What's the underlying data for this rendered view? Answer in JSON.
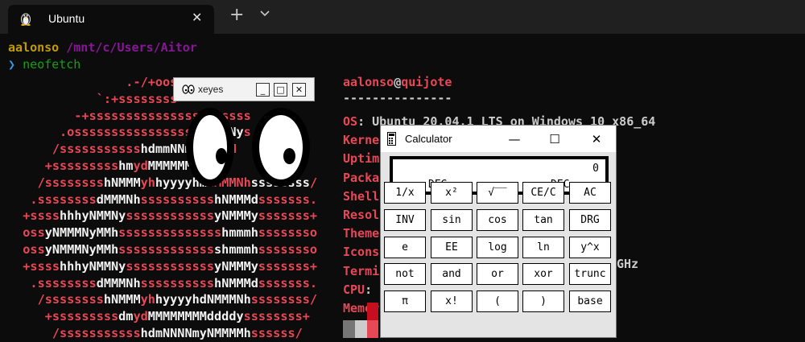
{
  "tab": {
    "title": "Ubuntu",
    "close": "✕",
    "icon": "linux-tux-icon"
  },
  "toolbar": {
    "new_tab": "+",
    "dropdown_icon": "chevron-down-icon"
  },
  "terminal": {
    "user": "aalonso",
    "path": "/mnt/c/Users/Aitor",
    "prompt_symbol": "❯",
    "command": "neofetch"
  },
  "neofetch": {
    "header_user": "aalonso",
    "header_at": "@",
    "header_host": "quijote",
    "separator": "---------------",
    "info": [
      {
        "key": "OS",
        "sep": ": ",
        "value": "Ubuntu 20.04.1 LTS on Windows 10 x86_64"
      },
      {
        "key": "Kerne",
        "sep": "",
        "value": ""
      },
      {
        "key": "Uptim",
        "sep": "",
        "value": ""
      },
      {
        "key": "Packa",
        "sep": "",
        "value": ""
      },
      {
        "key": "Shell",
        "sep": "",
        "value": ""
      },
      {
        "key": "Resol",
        "sep": "",
        "value": ""
      },
      {
        "key": "Theme",
        "sep": "",
        "value": ""
      },
      {
        "key": "Icons",
        "sep": "",
        "value": ""
      },
      {
        "key": "Termi",
        "sep": "",
        "value": ""
      },
      {
        "key": "CPU",
        "sep": ": ",
        "value": ""
      },
      {
        "key": "Memor",
        "sep": "",
        "value": ""
      }
    ],
    "cpu_tail": "GHz",
    "color_blocks": [
      "#c50f1f",
      "#e74856",
      "#767676",
      "#cccccc"
    ]
  },
  "logo_lines": [
    [
      [
        "r",
        "                .-/+oosss"
      ]
    ],
    [
      [
        "r",
        "            `:+ssssssss"
      ]
    ],
    [
      [
        "r",
        "         -+sssssssssssssssss"
      ],
      [
        "w",
        "y"
      ],
      [
        "r",
        "ssss"
      ]
    ],
    [
      [
        "r",
        "       .osssssssssssssssss"
      ],
      [
        "w",
        "dMMMNy"
      ],
      [
        "r",
        "s"
      ]
    ],
    [
      [
        "r",
        "      /sssssssssss"
      ],
      [
        "w",
        "hdmmNNm"
      ],
      [
        "r",
        "mmMMMM"
      ]
    ],
    [
      [
        "r",
        "     +sssssssss"
      ],
      [
        "w",
        "hm"
      ],
      [
        "r",
        "yd"
      ],
      [
        "w",
        "MMMMMM"
      ]
    ],
    [
      [
        "r",
        "    /ssssssss"
      ],
      [
        "w",
        "hNMMM"
      ],
      [
        "r",
        "yh"
      ],
      [
        "w",
        "hyyyyhm"
      ],
      [
        "r",
        "NMMMNh"
      ],
      [
        "w",
        "ssssssss"
      ],
      [
        "r",
        "/"
      ]
    ],
    [
      [
        "r",
        "   .ssssssss"
      ],
      [
        "w",
        "dMMMNh"
      ],
      [
        "r",
        "ssssssssss"
      ],
      [
        "w",
        "hNMMMd"
      ],
      [
        "r",
        "sssssss."
      ]
    ],
    [
      [
        "r",
        "  +ssss"
      ],
      [
        "w",
        "hhhyNMMNy"
      ],
      [
        "r",
        "ssssssssssss"
      ],
      [
        "w",
        "yNMMMy"
      ],
      [
        "r",
        "sssssss+"
      ]
    ],
    [
      [
        "r",
        "  oss"
      ],
      [
        "w",
        "yNMMMNyMMh"
      ],
      [
        "r",
        "ssssssssssssss"
      ],
      [
        "w",
        "hmmmh"
      ],
      [
        "r",
        "ssssssso"
      ]
    ],
    [
      [
        "r",
        "  oss"
      ],
      [
        "w",
        "yNMMMNyMMh"
      ],
      [
        "r",
        "sssssssssssss"
      ],
      [
        "w",
        "shmmmh"
      ],
      [
        "r",
        "ssssssso"
      ]
    ],
    [
      [
        "r",
        "  +ssss"
      ],
      [
        "w",
        "hhhyNMMNy"
      ],
      [
        "r",
        "ssssssssssss"
      ],
      [
        "w",
        "yNMMMy"
      ],
      [
        "r",
        "sssssss+"
      ]
    ],
    [
      [
        "r",
        "   .ssssssss"
      ],
      [
        "w",
        "dMMMNh"
      ],
      [
        "r",
        "ssssssssss"
      ],
      [
        "w",
        "hNMMMd"
      ],
      [
        "r",
        "sssssss."
      ]
    ],
    [
      [
        "r",
        "    /ssssssss"
      ],
      [
        "w",
        "hNMMM"
      ],
      [
        "r",
        "yh"
      ],
      [
        "w",
        "hyyyyhdNMMMNh"
      ],
      [
        "r",
        "ssssssss/"
      ]
    ],
    [
      [
        "r",
        "     +sssssssss"
      ],
      [
        "w",
        "dm"
      ],
      [
        "r",
        "yd"
      ],
      [
        "w",
        "MMMMMMMMddddy"
      ],
      [
        "r",
        "ssssssss+"
      ]
    ],
    [
      [
        "r",
        "      /sssssssssss"
      ],
      [
        "w",
        "hdmNNNNmyNMMMMh"
      ],
      [
        "r",
        "ssssss/"
      ]
    ]
  ],
  "xeyes": {
    "title": "xeyes",
    "minimize": "_",
    "maximize": "□",
    "close": "✕",
    "icon": "xeyes-app-icon"
  },
  "calculator": {
    "title": "Calculator",
    "icon": "calculator-app-icon",
    "controls": {
      "minimize": "—",
      "maximize": "☐",
      "close": "✕"
    },
    "display": {
      "value": "0",
      "angle_mode": "DEG",
      "base_mode": "DEC"
    },
    "keys": [
      [
        "1/x",
        "x²",
        "√‾‾",
        "CE/C",
        "AC"
      ],
      [
        "INV",
        "sin",
        "cos",
        "tan",
        "DRG"
      ],
      [
        "e",
        "EE",
        "log",
        "ln",
        "y^x"
      ],
      [
        "not",
        "and",
        "or",
        "xor",
        "trunc"
      ],
      [
        "π",
        "x!",
        "(",
        ")",
        "base"
      ]
    ]
  }
}
